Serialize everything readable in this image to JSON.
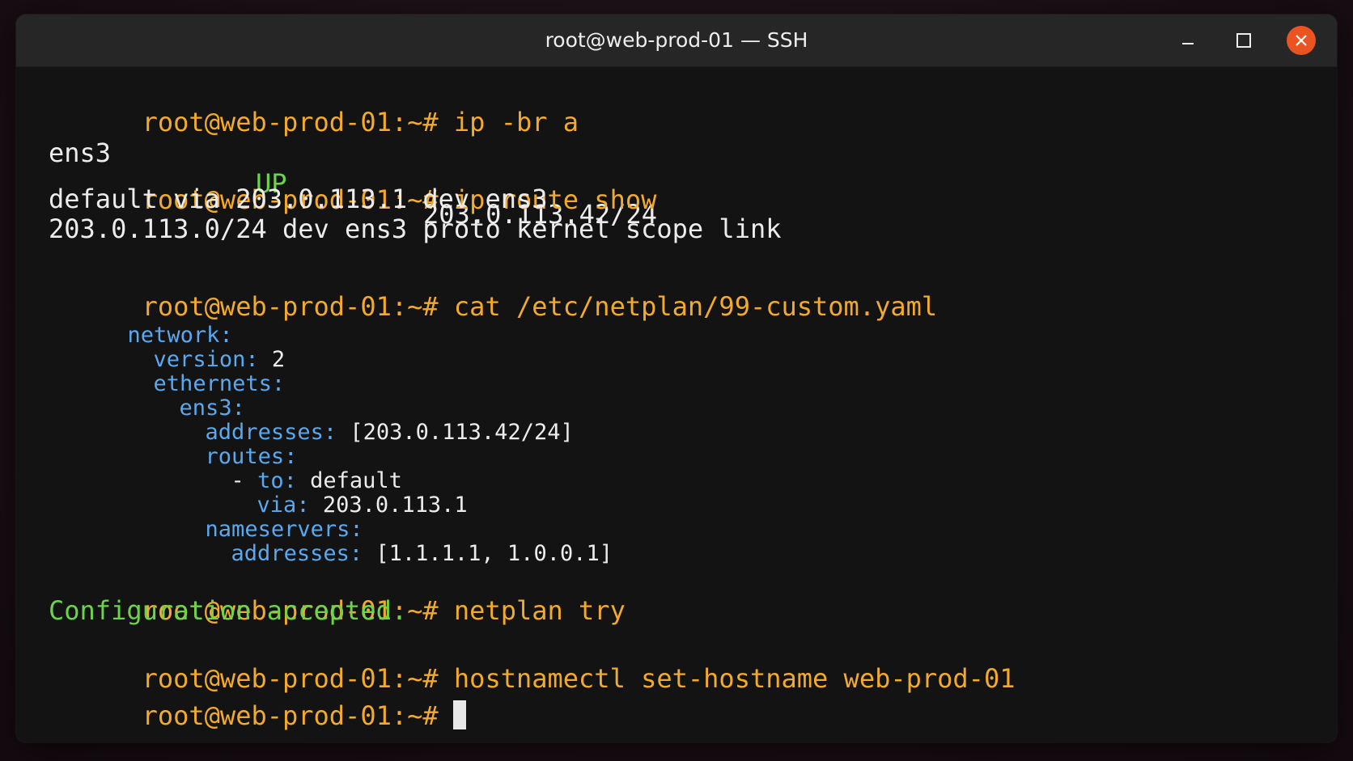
{
  "window": {
    "title": "root@web-prod-01 — SSH",
    "close_color": "#e95420"
  },
  "terminal": {
    "prompt": "root@web-prod-01:~#",
    "cmd1": "ip -br a",
    "iface_name": "ens3",
    "iface_state": "UP",
    "iface_addr": "203.0.113.42/24",
    "cmd2": "ip route show",
    "route1": "default via 203.0.113.1 dev ens3",
    "route2": "203.0.113.0/24 dev ens3 proto kernel scope link",
    "cmd3": "cat /etc/netplan/99-custom.yaml",
    "yaml": {
      "network_key": "network:",
      "version_key": "version:",
      "version_val": "2",
      "ethernets_key": "ethernets:",
      "ens3_key": "ens3:",
      "addresses_key": "addresses:",
      "addresses_val": "[203.0.113.42/24]",
      "routes_key": "routes:",
      "route_dash": "-",
      "to_key": "to:",
      "to_val": "default",
      "via_key": "via:",
      "via_val": "203.0.113.1",
      "nameservers_key": "nameservers:",
      "ns_addresses_key": "addresses:",
      "ns_addresses_val": "[1.1.1.1, 1.0.0.1]"
    },
    "cmd4": "netplan try",
    "result4": "Configuration accepted.",
    "cmd5": "hostnamectl set-hostname web-prod-01",
    "cmd6": ""
  }
}
